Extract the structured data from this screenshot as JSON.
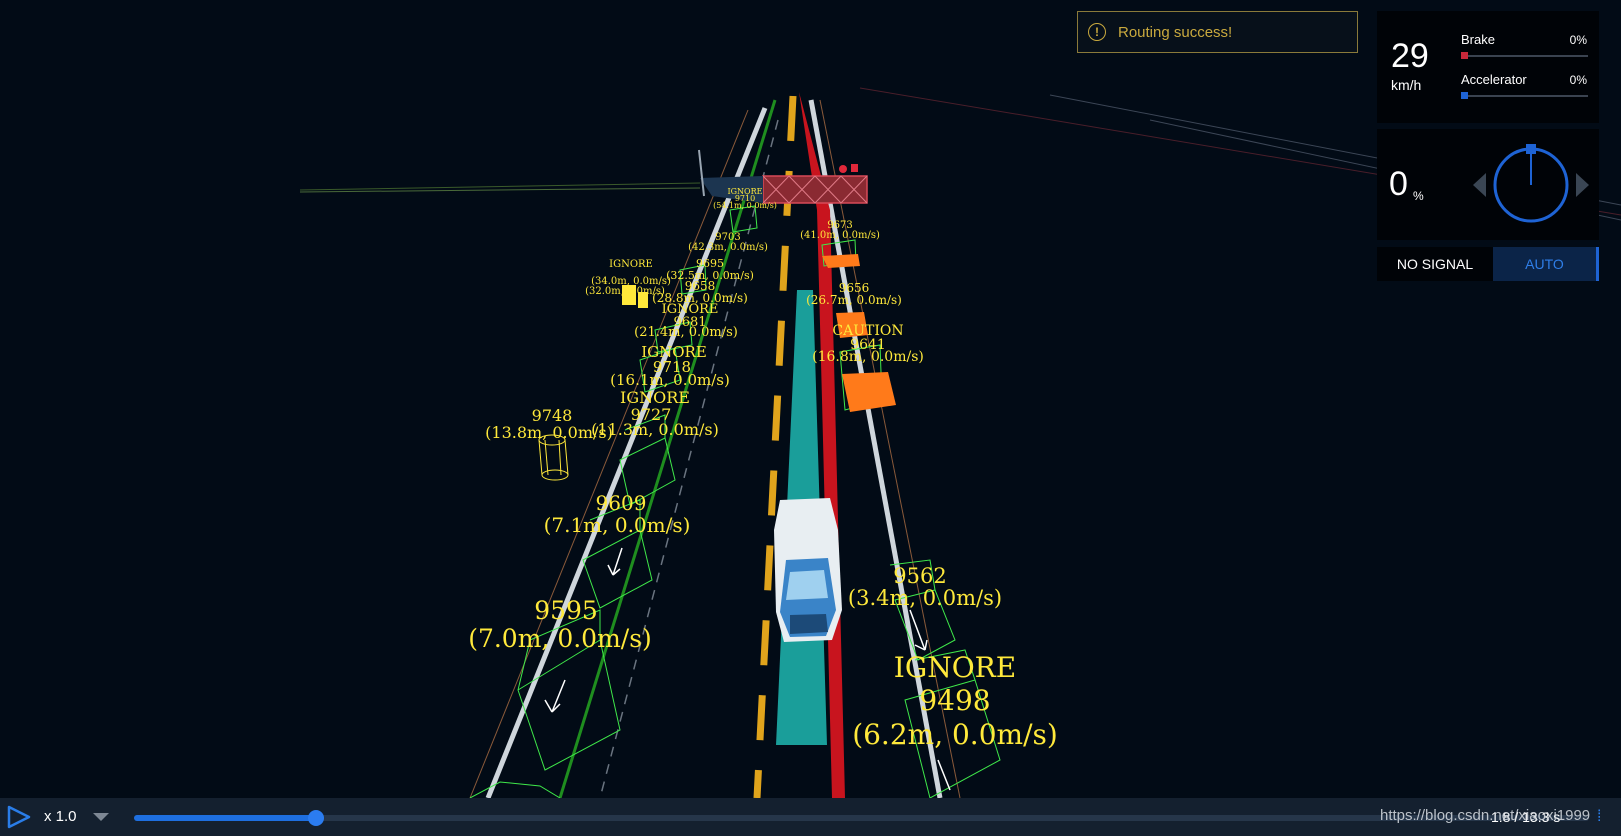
{
  "notification": {
    "text": "Routing success!",
    "icon": "warning-circle-icon"
  },
  "dashboard": {
    "speed": {
      "value": "29",
      "unit": "km/h"
    },
    "brake": {
      "label": "Brake",
      "percent": "0%",
      "level": 0,
      "color": "#c8283a"
    },
    "accelerator": {
      "label": "Accelerator",
      "percent": "0%",
      "level": 0,
      "color": "#1e63d4"
    },
    "steering": {
      "value": "0",
      "unit": "%",
      "angle": 0
    },
    "signal": "NO SIGNAL",
    "mode": "AUTO"
  },
  "obstacles": [
    {
      "lines": [
        "IGNORE",
        "9710",
        "(54.1m, 0.0m/s)"
      ]
    },
    {
      "lines": [
        "9673",
        "(41.0m, 0.0m/s)"
      ]
    },
    {
      "lines": [
        "9703",
        "(42.3m, 0.0m/s)"
      ]
    },
    {
      "lines": [
        "9695",
        "(32.5m, 0.0m/s)"
      ]
    },
    {
      "lines": [
        "9658",
        "(28.8m, 0.0m/s)"
      ]
    },
    {
      "lines": [
        "IGNORE",
        "(34.0m, 0.0m/s)",
        "(32.0m, 0.0m/s)"
      ]
    },
    {
      "lines": [
        "9656",
        "(26.7m, 0.0m/s)"
      ]
    },
    {
      "lines": [
        "IGNORE",
        "9681",
        "(21.4m, 0.0m/s)"
      ]
    },
    {
      "lines": [
        "CAUTION",
        "9641",
        "(16.8m, 0.0m/s)"
      ]
    },
    {
      "lines": [
        "IGNORE",
        "9718",
        "(16.1m, 0.0m/s)"
      ]
    },
    {
      "lines": [
        "IGNORE",
        "9727",
        "(11.3m, 0.0m/s)"
      ]
    },
    {
      "lines": [
        "9748",
        "(13.8m, 0.0m/s)"
      ]
    },
    {
      "lines": [
        "9609",
        "(7.1m, 0.0m/s)"
      ]
    },
    {
      "lines": [
        "9562",
        "(3.4m, 0.0m/s)"
      ]
    },
    {
      "lines": [
        "9595",
        "(7.0m, 0.0m/s)"
      ]
    },
    {
      "lines": [
        "IGNORE",
        "9498",
        "(6.2m, 0.0m/s)"
      ]
    }
  ],
  "playback": {
    "rate": "x 1.0",
    "time": "1.8 / 13.3 s",
    "progress": 0.125,
    "watermark": "https://blog.csdn.net/xiaoxi1999"
  },
  "colors": {
    "background": "#020b16",
    "label": "#ffe93b",
    "planning_path": "#1a9e9a",
    "reference_line": "#c8141e",
    "obstacle_box": "#3fe84a",
    "caution": "#ff7a1a",
    "accent": "#1e6fe0"
  }
}
